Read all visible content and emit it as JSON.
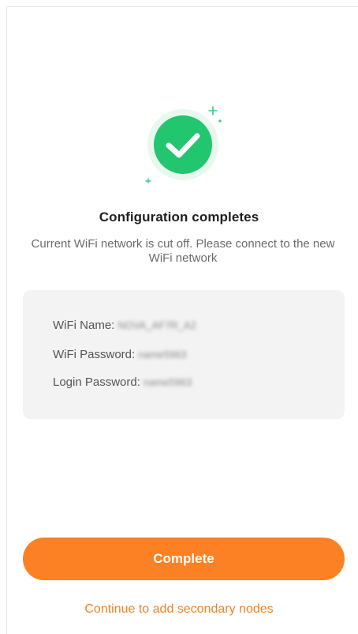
{
  "icons": {
    "success": "check-circle-icon",
    "sparkles": "sparkle-icon"
  },
  "colors": {
    "success_green": "#22c66e",
    "accent_orange": "#fb8124",
    "link_orange": "#f48224",
    "card_bg": "#f3f3f3"
  },
  "result": {
    "title": "Configuration completes",
    "message": "Current WiFi network is cut off. Please connect to the new WiFi network"
  },
  "credentials": {
    "wifi_name_label": "WiFi Name:",
    "wifi_name_value": "NOVA_AF7R_A2",
    "wifi_password_label": "WiFi Password:",
    "wifi_password_value": "name5963",
    "login_password_label": "Login Password:",
    "login_password_value": "name5963"
  },
  "actions": {
    "complete_label": "Complete",
    "add_secondary_label": "Continue to add secondary nodes"
  }
}
